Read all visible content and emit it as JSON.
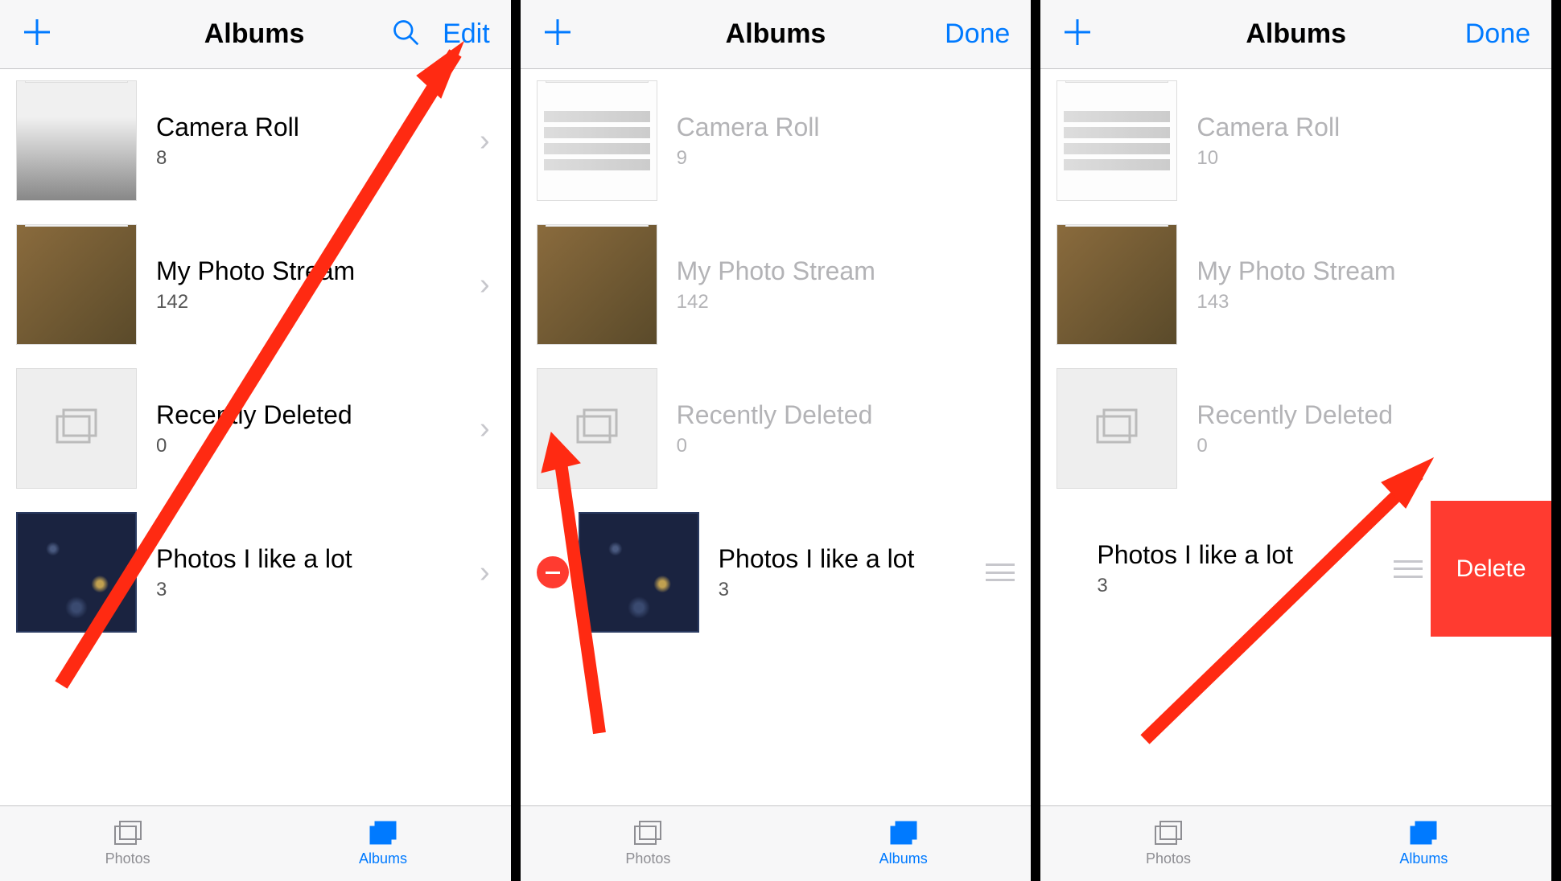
{
  "panels": [
    {
      "nav": {
        "title": "Albums",
        "right_action": "Edit",
        "show_search": true
      },
      "albums": [
        {
          "title": "Camera Roll",
          "count": "8"
        },
        {
          "title": "My Photo Stream",
          "count": "142"
        },
        {
          "title": "Recently Deleted",
          "count": "0"
        },
        {
          "title": "Photos I like a lot",
          "count": "3"
        }
      ]
    },
    {
      "nav": {
        "title": "Albums",
        "right_action": "Done",
        "show_search": false
      },
      "albums": [
        {
          "title": "Camera Roll",
          "count": "9"
        },
        {
          "title": "My Photo Stream",
          "count": "142"
        },
        {
          "title": "Recently Deleted",
          "count": "0"
        },
        {
          "title": "Photos I like a lot",
          "count": "3"
        }
      ]
    },
    {
      "nav": {
        "title": "Albums",
        "right_action": "Done",
        "show_search": false
      },
      "albums": [
        {
          "title": "Camera Roll",
          "count": "10"
        },
        {
          "title": "My Photo Stream",
          "count": "143"
        },
        {
          "title": "Recently Deleted",
          "count": "0"
        },
        {
          "title": "Photos I like a lot",
          "count": "3"
        }
      ],
      "delete_label": "Delete"
    }
  ],
  "tabs": {
    "photos": "Photos",
    "albums": "Albums"
  }
}
